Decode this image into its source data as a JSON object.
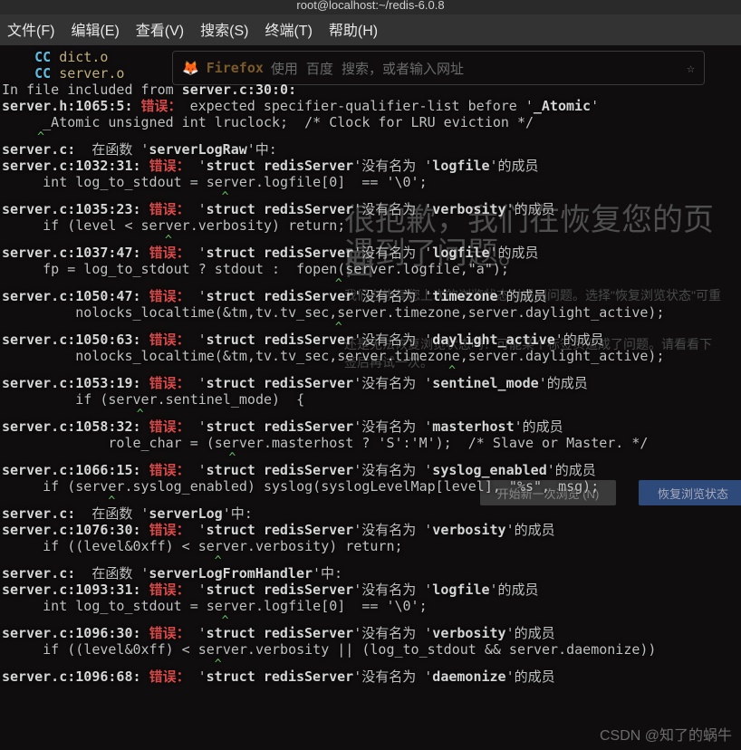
{
  "window": {
    "title": "root@localhost:~/redis-6.0.8"
  },
  "menu": {
    "file": "文件(F)",
    "edit": "编辑(E)",
    "view": "查看(V)",
    "search": "搜索(S)",
    "terminal": "终端(T)",
    "help": "帮助(H)"
  },
  "browser_underlay": {
    "fx_label": "Firefox",
    "url_placeholder": "使用 百度 搜索，或者输入网址",
    "star": "☆",
    "crash_title_line1": "很抱歉，我们在恢复您的页面",
    "crash_title_line2": "遇到了问题。",
    "crash_msg1": "我们在恢复您上次的浏览状态时遇到问题。选择\"恢复浏览状态\"可重",
    "crash_msg2": "还是无法恢复浏览状态吗？可能某个标签页造成了问题。请看看下",
    "crash_msg3": "签后再试一次。",
    "btn_new": "开始新一次浏览 (N)",
    "btn_restore": "恢复浏览状态"
  },
  "lines": [
    {
      "cls": "",
      "segs": [
        {
          "c": "cyan",
          "t": "    CC "
        },
        {
          "c": "ylw",
          "t": "dict.o"
        }
      ]
    },
    {
      "cls": "",
      "segs": [
        {
          "c": "cyan",
          "t": "    CC "
        },
        {
          "c": "ylw",
          "t": "server.o"
        }
      ]
    },
    {
      "cls": "",
      "segs": [
        {
          "c": "dim",
          "t": "In file included from "
        },
        {
          "c": "wht",
          "t": "server.c:30:0:"
        }
      ]
    },
    {
      "cls": "",
      "segs": [
        {
          "c": "wht",
          "t": "server.h:1065:5: "
        },
        {
          "c": "red",
          "t": "错误："
        },
        {
          "c": "dim",
          "t": " expected specifier-qualifier-list before '"
        },
        {
          "c": "wht",
          "t": "_Atomic"
        },
        {
          "c": "dim",
          "t": "'"
        }
      ]
    },
    {
      "cls": "",
      "segs": [
        {
          "c": "dim",
          "t": "     _Atomic unsigned int lruclock;  /* Clock for LRU eviction */"
        }
      ]
    },
    {
      "cls": "caretline",
      "segs": [
        {
          "c": "caret",
          "t": "     ^"
        }
      ]
    },
    {
      "cls": "",
      "segs": [
        {
          "c": "wht",
          "t": "server.c:"
        },
        {
          "c": "dim",
          "t": "  在函数 '"
        },
        {
          "c": "wht",
          "t": "serverLogRaw"
        },
        {
          "c": "dim",
          "t": "'中:"
        }
      ]
    },
    {
      "cls": "",
      "segs": [
        {
          "c": "wht",
          "t": "server.c:1032:31: "
        },
        {
          "c": "red",
          "t": "错误："
        },
        {
          "c": "dim",
          "t": " '"
        },
        {
          "c": "wht",
          "t": "struct redisServer"
        },
        {
          "c": "dim",
          "t": "'没有名为 '"
        },
        {
          "c": "wht",
          "t": "logfile"
        },
        {
          "c": "dim",
          "t": "'的成员"
        }
      ]
    },
    {
      "cls": "",
      "segs": [
        {
          "c": "dim",
          "t": "     int log_to_stdout = server.logfile[0]  == '\\0';"
        }
      ]
    },
    {
      "cls": "caretline",
      "segs": [
        {
          "c": "caret",
          "t": "                               ^"
        }
      ]
    },
    {
      "cls": "",
      "segs": [
        {
          "c": "wht",
          "t": "server.c:1035:23: "
        },
        {
          "c": "red",
          "t": "错误："
        },
        {
          "c": "dim",
          "t": " '"
        },
        {
          "c": "wht",
          "t": "struct redisServer"
        },
        {
          "c": "dim",
          "t": "'没有名为 '"
        },
        {
          "c": "wht",
          "t": "verbosity"
        },
        {
          "c": "dim",
          "t": "'的成员"
        }
      ]
    },
    {
      "cls": "",
      "segs": [
        {
          "c": "dim",
          "t": "     if (level < server.verbosity) return;"
        }
      ]
    },
    {
      "cls": "caretline",
      "segs": [
        {
          "c": "caret",
          "t": "                       ^"
        }
      ]
    },
    {
      "cls": "",
      "segs": [
        {
          "c": "wht",
          "t": "server.c:1037:47: "
        },
        {
          "c": "red",
          "t": "错误："
        },
        {
          "c": "dim",
          "t": " '"
        },
        {
          "c": "wht",
          "t": "struct redisServer"
        },
        {
          "c": "dim",
          "t": "'没有名为 '"
        },
        {
          "c": "wht",
          "t": "logfile"
        },
        {
          "c": "dim",
          "t": "'的成员"
        }
      ]
    },
    {
      "cls": "",
      "segs": [
        {
          "c": "dim",
          "t": "     fp = log_to_stdout ? stdout :  fopen(server.logfile,\"a\");"
        }
      ]
    },
    {
      "cls": "caretline",
      "segs": [
        {
          "c": "caret",
          "t": "                                               ^"
        }
      ]
    },
    {
      "cls": "",
      "segs": [
        {
          "c": "wht",
          "t": "server.c:1050:47: "
        },
        {
          "c": "red",
          "t": "错误："
        },
        {
          "c": "dim",
          "t": " '"
        },
        {
          "c": "wht",
          "t": "struct redisServer"
        },
        {
          "c": "dim",
          "t": "'没有名为 '"
        },
        {
          "c": "wht",
          "t": "timezone"
        },
        {
          "c": "dim",
          "t": "'的成员"
        }
      ]
    },
    {
      "cls": "",
      "segs": [
        {
          "c": "dim",
          "t": "         nolocks_localtime(&tm,tv.tv_sec,server.timezone,server.daylight_active);"
        }
      ]
    },
    {
      "cls": "caretline",
      "segs": [
        {
          "c": "caret",
          "t": "                                               ^"
        }
      ]
    },
    {
      "cls": "",
      "segs": [
        {
          "c": "wht",
          "t": "server.c:1050:63: "
        },
        {
          "c": "red",
          "t": "错误："
        },
        {
          "c": "dim",
          "t": " '"
        },
        {
          "c": "wht",
          "t": "struct redisServer"
        },
        {
          "c": "dim",
          "t": "'没有名为 '"
        },
        {
          "c": "wht",
          "t": "daylight_active"
        },
        {
          "c": "dim",
          "t": "'的成员"
        }
      ]
    },
    {
      "cls": "",
      "segs": [
        {
          "c": "dim",
          "t": "         nolocks_localtime(&tm,tv.tv_sec,server.timezone,server.daylight_active);"
        }
      ]
    },
    {
      "cls": "caretline",
      "segs": [
        {
          "c": "caret",
          "t": "                                                               ^"
        }
      ]
    },
    {
      "cls": "",
      "segs": [
        {
          "c": "wht",
          "t": "server.c:1053:19: "
        },
        {
          "c": "red",
          "t": "错误："
        },
        {
          "c": "dim",
          "t": " '"
        },
        {
          "c": "wht",
          "t": "struct redisServer"
        },
        {
          "c": "dim",
          "t": "'没有名为 '"
        },
        {
          "c": "wht",
          "t": "sentinel_mode"
        },
        {
          "c": "dim",
          "t": "'的成员"
        }
      ]
    },
    {
      "cls": "",
      "segs": [
        {
          "c": "dim",
          "t": "         if (server.sentinel_mode)  {"
        }
      ]
    },
    {
      "cls": "caretline",
      "segs": [
        {
          "c": "caret",
          "t": "                   ^"
        }
      ]
    },
    {
      "cls": "",
      "segs": [
        {
          "c": "wht",
          "t": "server.c:1058:32: "
        },
        {
          "c": "red",
          "t": "错误："
        },
        {
          "c": "dim",
          "t": " '"
        },
        {
          "c": "wht",
          "t": "struct redisServer"
        },
        {
          "c": "dim",
          "t": "'没有名为 '"
        },
        {
          "c": "wht",
          "t": "masterhost"
        },
        {
          "c": "dim",
          "t": "'的成员"
        }
      ]
    },
    {
      "cls": "",
      "segs": [
        {
          "c": "dim",
          "t": "             role_char = (server.masterhost ? 'S':'M');  /* Slave or Master. */"
        }
      ]
    },
    {
      "cls": "caretline",
      "segs": [
        {
          "c": "caret",
          "t": "                                ^"
        }
      ]
    },
    {
      "cls": "",
      "segs": [
        {
          "c": "wht",
          "t": "server.c:1066:15: "
        },
        {
          "c": "red",
          "t": "错误："
        },
        {
          "c": "dim",
          "t": " '"
        },
        {
          "c": "wht",
          "t": "struct redisServer"
        },
        {
          "c": "dim",
          "t": "'没有名为 '"
        },
        {
          "c": "wht",
          "t": "syslog_enabled"
        },
        {
          "c": "dim",
          "t": "'的成员"
        }
      ]
    },
    {
      "cls": "",
      "segs": [
        {
          "c": "dim",
          "t": "     if (server.syslog_enabled) syslog(syslogLevelMap[level], \"%s\", msg);"
        }
      ]
    },
    {
      "cls": "caretline",
      "segs": [
        {
          "c": "caret",
          "t": "               ^"
        }
      ]
    },
    {
      "cls": "",
      "segs": [
        {
          "c": "wht",
          "t": "server.c:"
        },
        {
          "c": "dim",
          "t": "  在函数 '"
        },
        {
          "c": "wht",
          "t": "serverLog"
        },
        {
          "c": "dim",
          "t": "'中:"
        }
      ]
    },
    {
      "cls": "",
      "segs": [
        {
          "c": "wht",
          "t": "server.c:1076:30: "
        },
        {
          "c": "red",
          "t": "错误："
        },
        {
          "c": "dim",
          "t": " '"
        },
        {
          "c": "wht",
          "t": "struct redisServer"
        },
        {
          "c": "dim",
          "t": "'没有名为 '"
        },
        {
          "c": "wht",
          "t": "verbosity"
        },
        {
          "c": "dim",
          "t": "'的成员"
        }
      ]
    },
    {
      "cls": "",
      "segs": [
        {
          "c": "dim",
          "t": "     if ((level&0xff) < server.verbosity) return;"
        }
      ]
    },
    {
      "cls": "caretline",
      "segs": [
        {
          "c": "caret",
          "t": "                              ^"
        }
      ]
    },
    {
      "cls": "",
      "segs": [
        {
          "c": "wht",
          "t": "server.c:"
        },
        {
          "c": "dim",
          "t": "  在函数 '"
        },
        {
          "c": "wht",
          "t": "serverLogFromHandler"
        },
        {
          "c": "dim",
          "t": "'中:"
        }
      ]
    },
    {
      "cls": "",
      "segs": [
        {
          "c": "wht",
          "t": "server.c:1093:31: "
        },
        {
          "c": "red",
          "t": "错误："
        },
        {
          "c": "dim",
          "t": " '"
        },
        {
          "c": "wht",
          "t": "struct redisServer"
        },
        {
          "c": "dim",
          "t": "'没有名为 '"
        },
        {
          "c": "wht",
          "t": "logfile"
        },
        {
          "c": "dim",
          "t": "'的成员"
        }
      ]
    },
    {
      "cls": "",
      "segs": [
        {
          "c": "dim",
          "t": "     int log_to_stdout = server.logfile[0]  == '\\0';"
        }
      ]
    },
    {
      "cls": "caretline",
      "segs": [
        {
          "c": "caret",
          "t": "                               ^"
        }
      ]
    },
    {
      "cls": "",
      "segs": [
        {
          "c": "wht",
          "t": "server.c:1096:30: "
        },
        {
          "c": "red",
          "t": "错误："
        },
        {
          "c": "dim",
          "t": " '"
        },
        {
          "c": "wht",
          "t": "struct redisServer"
        },
        {
          "c": "dim",
          "t": "'没有名为 '"
        },
        {
          "c": "wht",
          "t": "verbosity"
        },
        {
          "c": "dim",
          "t": "'的成员"
        }
      ]
    },
    {
      "cls": "",
      "segs": [
        {
          "c": "dim",
          "t": "     if ((level&0xff) < server.verbosity || (log_to_stdout && server.daemonize))"
        }
      ]
    },
    {
      "cls": "caretline",
      "segs": [
        {
          "c": "caret",
          "t": "                              ^"
        }
      ]
    },
    {
      "cls": "",
      "segs": [
        {
          "c": "wht",
          "t": "server.c:1096:68: "
        },
        {
          "c": "red",
          "t": "错误："
        },
        {
          "c": "dim",
          "t": " '"
        },
        {
          "c": "wht",
          "t": "struct redisServer"
        },
        {
          "c": "dim",
          "t": "'没有名为 '"
        },
        {
          "c": "wht",
          "t": "daemonize"
        },
        {
          "c": "dim",
          "t": "'的成员"
        }
      ]
    }
  ],
  "watermark": "CSDN @知了的蜗牛"
}
